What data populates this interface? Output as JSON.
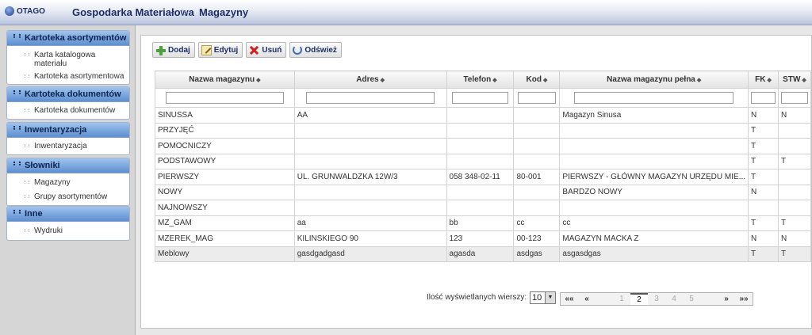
{
  "header": {
    "logo": "OTAGO",
    "title": "Gospodarka Materiałowa",
    "separator": "▷",
    "section": "Magazyny"
  },
  "sidebar": {
    "panels": [
      {
        "title": "Kartoteka asortymentów",
        "items": [
          "Karta katalogowa materiału",
          "Kartoteka asortymentowa"
        ]
      },
      {
        "title": "Kartoteka dokumentów",
        "items": [
          "Kartoteka dokumentów"
        ]
      },
      {
        "title": "Inwentaryzacja",
        "items": [
          "Inwentaryzacja"
        ]
      },
      {
        "title": "Słowniki",
        "items": [
          "Magazyny",
          "Grupy asortymentów"
        ]
      },
      {
        "title": "Inne",
        "items": [
          "Wydruki"
        ]
      }
    ]
  },
  "toolbar": {
    "add": "Dodaj",
    "edit": "Edytuj",
    "delete": "Usuń",
    "refresh": "Odśwież"
  },
  "table": {
    "sort_glyph": "◆",
    "columns": [
      "Nazwa magazynu",
      "Adres",
      "Telefon",
      "Kod",
      "Nazwa magazynu pełna",
      "FK",
      "STW"
    ],
    "rows": [
      [
        "SINUSSA",
        "AA",
        "",
        "",
        "Magazyn Sinusa",
        "N",
        "N"
      ],
      [
        "PRZYJĘĆ",
        "",
        "",
        "",
        "",
        "T",
        ""
      ],
      [
        "POMOCNICZY",
        "",
        "",
        "",
        "",
        "T",
        ""
      ],
      [
        "PODSTAWOWY",
        "",
        "",
        "",
        "",
        "T",
        "T"
      ],
      [
        "PIERWSZY",
        "UL. GRUNWALDZKA 12W/3",
        "058 348-02-11",
        "80-001",
        "PIERWSZY - GŁÓWNY MAGAZYN URZĘDU MIE...",
        "T",
        ""
      ],
      [
        "NOWY",
        "",
        "",
        "",
        "BARDZO NOWY",
        "N",
        ""
      ],
      [
        "NAJNOWSZY",
        "",
        "",
        "",
        "",
        "",
        ""
      ],
      [
        "MZ_GAM",
        "aa",
        "bb",
        "cc",
        "cc",
        "T",
        "T"
      ],
      [
        "MZEREK_MAG",
        "KILINSKIEGO 90",
        "123",
        "00-123",
        "MAGAZYN MACKA Z",
        "N",
        "N"
      ],
      [
        "Meblowy",
        "gasdgadgasd",
        "agasda",
        "asdgas",
        "asgasdgas",
        "T",
        "T"
      ]
    ]
  },
  "pager": {
    "label": "Ilość wyświetlanych wierszy:",
    "page_size": "10",
    "first": "««",
    "prev": "«",
    "pages": [
      "1",
      "2",
      "3",
      "4",
      "5"
    ],
    "current": "2",
    "next": "»",
    "last": "»»"
  }
}
